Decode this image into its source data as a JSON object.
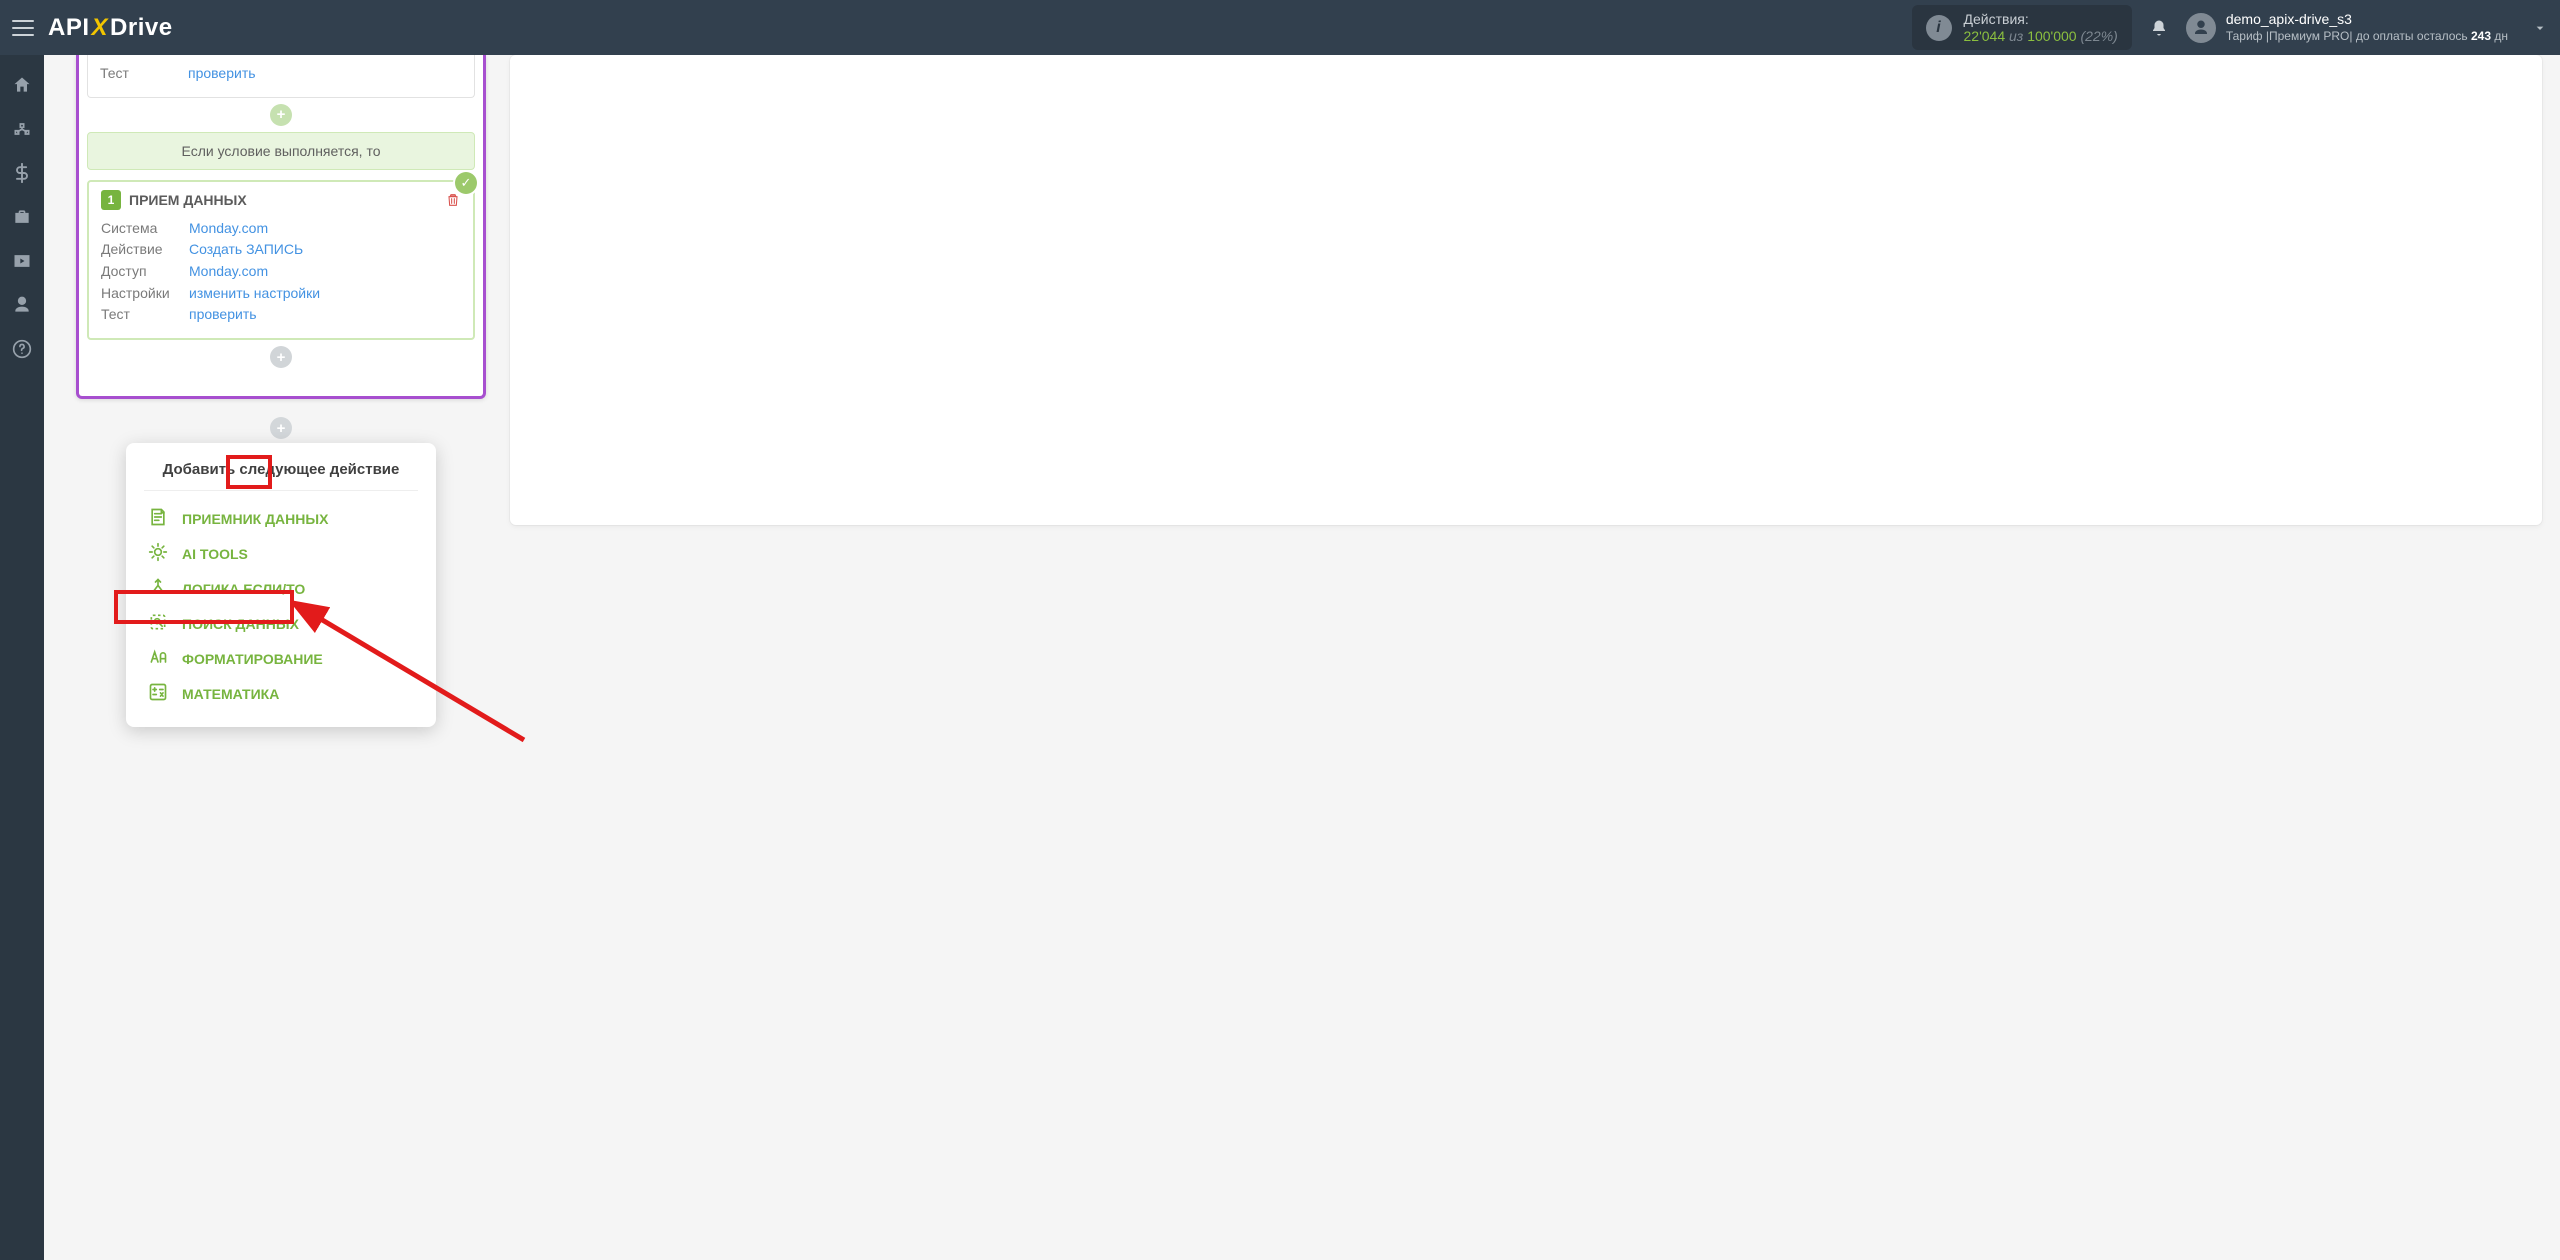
{
  "header": {
    "brand_api": "API",
    "brand_x": "X",
    "brand_drive": "Drive",
    "actions_label": "Действия:",
    "actions_used": "22'044",
    "actions_of": "из",
    "actions_total": "100'000",
    "actions_pct": "(22%)",
    "user_name": "demo_apix-drive_s3",
    "user_sub_prefix": "Тариф |Премиум PRO| до оплаты осталось ",
    "user_sub_days": "243",
    "user_sub_suffix": " дн"
  },
  "card_top": {
    "test_label": "Тест",
    "test_value": "проверить"
  },
  "cond_text": "Если условие выполняется, то",
  "card2": {
    "num": "1",
    "title": "ПРИЕМ ДАННЫХ",
    "rows": [
      {
        "k": "Система",
        "v": "Monday.com"
      },
      {
        "k": "Действие",
        "v": "Создать ЗАПИСЬ"
      },
      {
        "k": "Доступ",
        "v": "Monday.com"
      },
      {
        "k": "Настройки",
        "v": "изменить настройки"
      },
      {
        "k": "Тест",
        "v": "проверить"
      }
    ]
  },
  "popup": {
    "title": "Добавить следующее действие",
    "items": [
      {
        "icon": "receiver",
        "label": "ПРИЕМНИК ДАННЫХ"
      },
      {
        "icon": "ai",
        "label": "AI TOOLS"
      },
      {
        "icon": "logic",
        "label": "ЛОГИКА ЕСЛИ/ТО"
      },
      {
        "icon": "search",
        "label": "ПОИСК ДАННЫХ"
      },
      {
        "icon": "format",
        "label": "ФОРМАТИРОВАНИЕ"
      },
      {
        "icon": "math",
        "label": "МАТЕМАТИКА"
      }
    ]
  }
}
